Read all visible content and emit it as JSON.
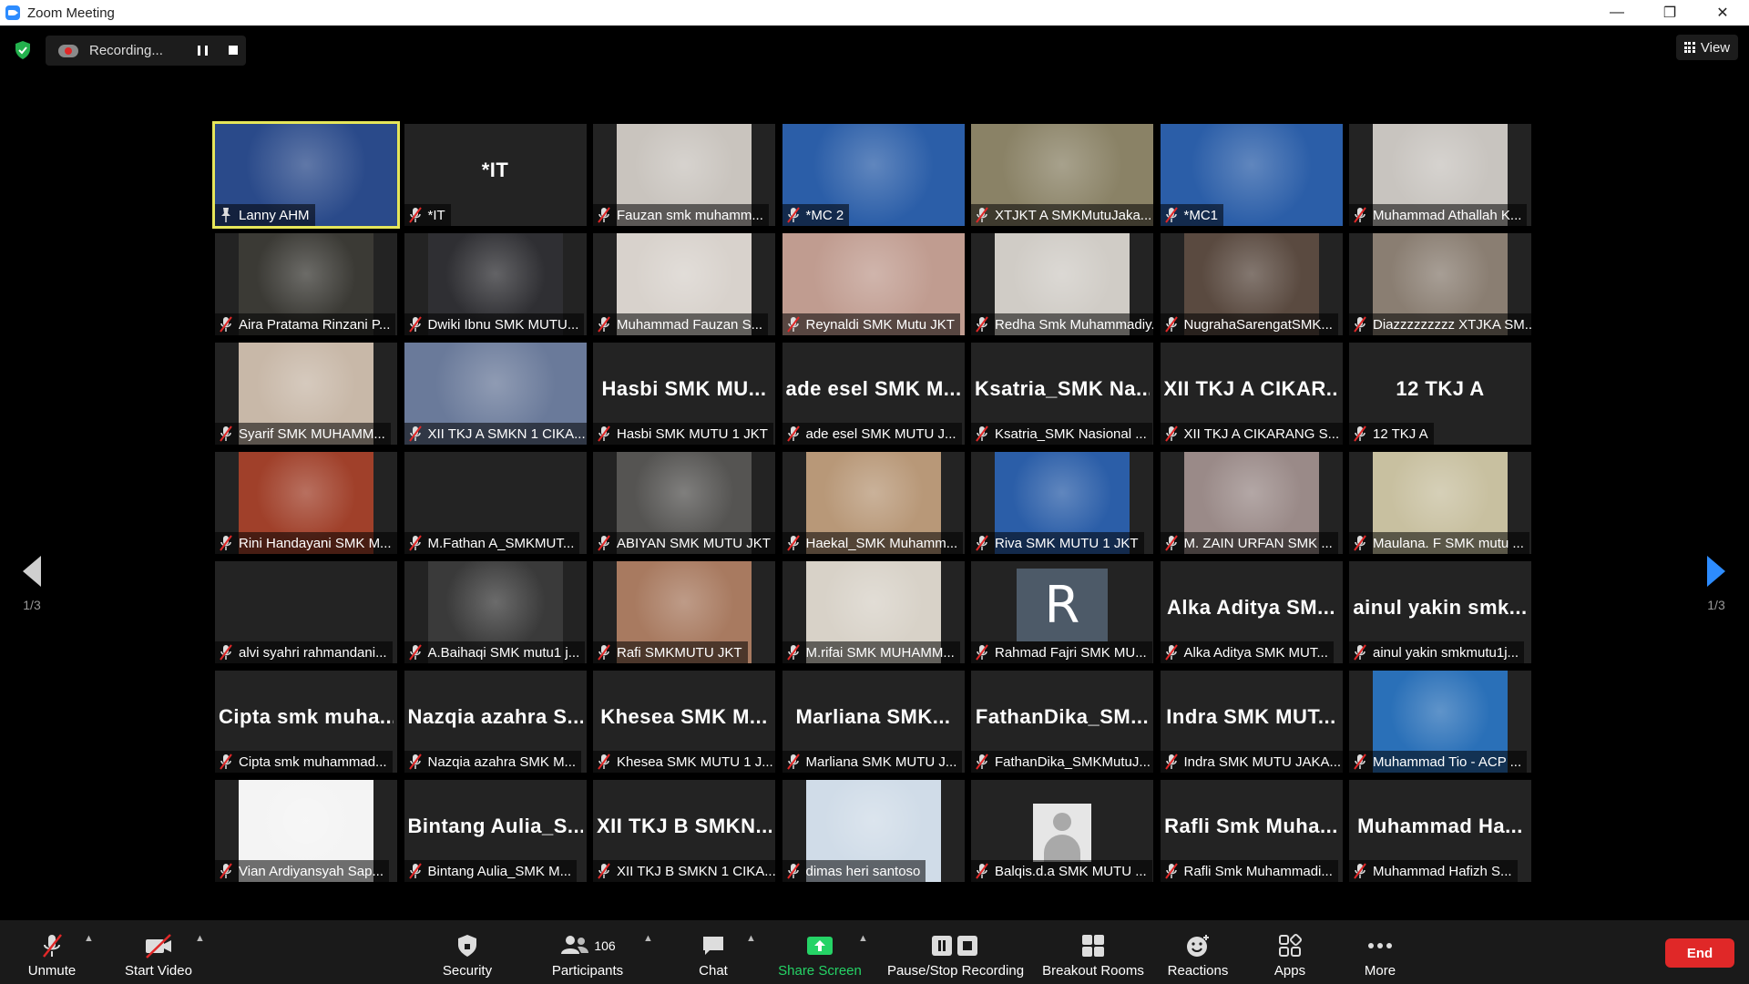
{
  "window": {
    "title": "Zoom Meeting",
    "controls": [
      "—",
      "❐",
      "✕"
    ]
  },
  "recording": {
    "label": "Recording..."
  },
  "view_button": {
    "label": "View"
  },
  "pager": {
    "left": "1/3",
    "right": "1/3"
  },
  "participants": [
    {
      "label": "Lanny AHM",
      "big": "",
      "video": "#2a4a8a",
      "active": true,
      "pinned": true
    },
    {
      "label": "*IT",
      "big": "*IT",
      "video": ""
    },
    {
      "label": "Fauzan smk muhamm...",
      "big": "",
      "video": "#c9c4be"
    },
    {
      "label": "*MC 2",
      "big": "",
      "video": "#2b5ea8"
    },
    {
      "label": "XTJKT A SMKMutuJaka...",
      "big": "",
      "video": "#8a8266"
    },
    {
      "label": "*MC1",
      "big": "",
      "video": "#2b5ea8"
    },
    {
      "label": "Muhammad Athallah K...",
      "big": "",
      "video": "#c8c4bf"
    },
    {
      "label": "Aira Pratama Rinzani P...",
      "big": "",
      "video": "#3b3a35"
    },
    {
      "label": "Dwiki Ibnu SMK MUTU...",
      "big": "",
      "video": "#2f2f33"
    },
    {
      "label": "Muhammad Fauzan S...",
      "big": "",
      "video": "#d8d2cc"
    },
    {
      "label": "Reynaldi SMK Mutu JKT",
      "big": "",
      "video": "#c09c90"
    },
    {
      "label": "Redha Smk Muhammadiy...",
      "big": "",
      "video": "#d0ccc6"
    },
    {
      "label": "NugrahaSarengatSMK...",
      "big": "",
      "video": "#5a4a40"
    },
    {
      "label": "Diazzzzzzzzz XTJKA SM...",
      "big": "",
      "video": "#8a7e72"
    },
    {
      "label": "Syarif SMK MUHAMM...",
      "big": "",
      "video": "#c8b8a8"
    },
    {
      "label": "XII TKJ A SMKN 1 CIKA...",
      "big": "",
      "video": "#6a7a9a"
    },
    {
      "label": "Hasbi SMK MUTU 1 JKT",
      "big": "Hasbi SMK MU...",
      "video": ""
    },
    {
      "label": "ade esel SMK MUTU J...",
      "big": "ade esel SMK M...",
      "video": ""
    },
    {
      "label": "Ksatria_SMK Nasional ...",
      "big": "Ksatria_SMK Na...",
      "video": ""
    },
    {
      "label": "XII TKJ A CIKARANG S...",
      "big": "XII TKJ A CIKAR...",
      "video": ""
    },
    {
      "label": "12 TKJ A",
      "big": "12 TKJ A",
      "video": ""
    },
    {
      "label": "Rini Handayani SMK M...",
      "big": "",
      "video": "#a0402a"
    },
    {
      "label": "M.Fathan A_SMKMUT...",
      "big": "",
      "video": ""
    },
    {
      "label": "ABIYAN SMK MUTU JKT",
      "big": "",
      "video": "#555452"
    },
    {
      "label": "Haekal_SMK Muhamm...",
      "big": "",
      "video": "#b89878"
    },
    {
      "label": "Riva SMK MUTU 1 JKT",
      "big": "",
      "video": "#2b5ea8"
    },
    {
      "label": "M. ZAIN URFAN SMK ...",
      "big": "",
      "video": "#9a8a88"
    },
    {
      "label": "Maulana. F SMK mutu ...",
      "big": "",
      "video": "#c8c0a0"
    },
    {
      "label": "alvi syahri rahmandani...",
      "big": "",
      "video": ""
    },
    {
      "label": "A.Baihaqi SMK mutu1 j...",
      "big": "",
      "video": "#3a3a3a"
    },
    {
      "label": "Rafi SMKMUTU JKT",
      "big": "",
      "video": "#a87a60"
    },
    {
      "label": "M.rifai SMK MUHAMM...",
      "big": "",
      "video": "#d8d2c8"
    },
    {
      "label": "Rahmad Fajri SMK MU...",
      "big": "",
      "video": "",
      "avatar": "R"
    },
    {
      "label": "Alka Aditya SMK MUT...",
      "big": "Alka Aditya SM...",
      "video": ""
    },
    {
      "label": "ainul yakin smkmutu1j...",
      "big": "ainul yakin smk...",
      "video": ""
    },
    {
      "label": "Cipta smk muhammad...",
      "big": "Cipta smk muha...",
      "video": ""
    },
    {
      "label": "Nazqia azahra SMK M...",
      "big": "Nazqia azahra S...",
      "video": ""
    },
    {
      "label": "Khesea SMK MUTU 1 J...",
      "big": "Khesea SMK M...",
      "video": ""
    },
    {
      "label": "Marliana SMK MUTU J...",
      "big": "Marliana SMK...",
      "video": ""
    },
    {
      "label": "FathanDika_SMKMutuJ...",
      "big": "FathanDika_SM...",
      "video": ""
    },
    {
      "label": "Indra SMK MUTU JAKA...",
      "big": "Indra SMK MUT...",
      "video": ""
    },
    {
      "label": "Muhammad Tio - ACP ...",
      "big": "",
      "video": "#2a70b8"
    },
    {
      "label": "Vian Ardiyansyah Sap...",
      "big": "",
      "video": "#f4f4f4"
    },
    {
      "label": "Bintang Aulia_SMK M...",
      "big": "Bintang Aulia_S...",
      "video": ""
    },
    {
      "label": "XII TKJ B SMKN 1 CIKA...",
      "big": "XII TKJ B SMKN...",
      "video": ""
    },
    {
      "label": "dimas heri santoso",
      "big": "",
      "video": "#d0dce8"
    },
    {
      "label": "Balqis.d.a SMK MUTU ...",
      "big": "",
      "video": "",
      "avatar": "default"
    },
    {
      "label": "Rafli Smk Muhammadi...",
      "big": "Rafli Smk Muha...",
      "video": ""
    },
    {
      "label": "Muhammad Hafizh S...",
      "big": "Muhammad Ha...",
      "video": ""
    }
  ],
  "toolbar": {
    "unmute": "Unmute",
    "start_video": "Start Video",
    "security": "Security",
    "participants": "Participants",
    "participants_count": "106",
    "chat": "Chat",
    "share_screen": "Share Screen",
    "pause_stop_recording": "Pause/Stop Recording",
    "breakout_rooms": "Breakout Rooms",
    "reactions": "Reactions",
    "apps": "Apps",
    "more": "More",
    "end": "End"
  },
  "colors": {
    "accent": "#2d8cff",
    "end": "#e02828",
    "share_green": "#25d366",
    "active_speaker": "#e6e65a"
  }
}
